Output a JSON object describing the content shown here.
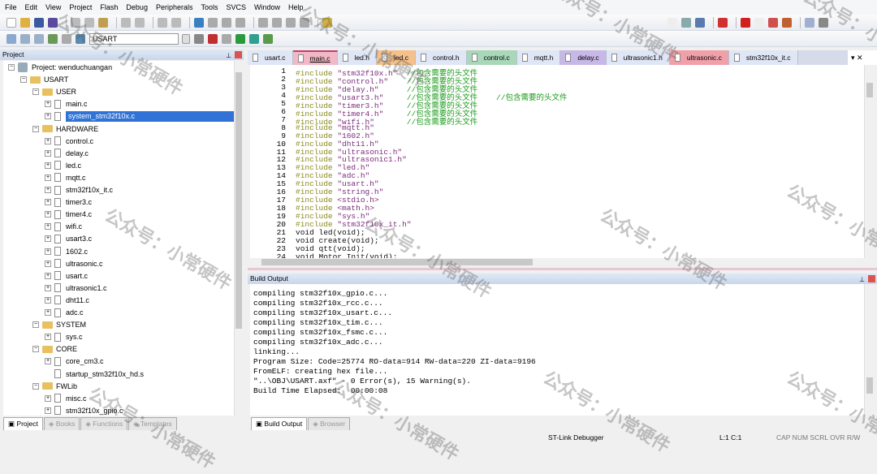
{
  "menu": [
    "File",
    "Edit",
    "View",
    "Project",
    "Flash",
    "Debug",
    "Peripherals",
    "Tools",
    "SVCS",
    "Window",
    "Help"
  ],
  "toolbar2": {
    "target": "USART"
  },
  "project_panel": {
    "title": "Project",
    "tree": [
      {
        "label": "Project: wenduchuangan",
        "level": 0,
        "type": "root"
      },
      {
        "label": "USART",
        "level": 1,
        "type": "target"
      },
      {
        "label": "USER",
        "level": 2,
        "type": "folder"
      },
      {
        "label": "main.c",
        "level": 3,
        "type": "file"
      },
      {
        "label": "system_stm32f10x.c",
        "level": 3,
        "type": "file",
        "selected": true
      },
      {
        "label": "HARDWARE",
        "level": 2,
        "type": "folder"
      },
      {
        "label": "control.c",
        "level": 3,
        "type": "file"
      },
      {
        "label": "delay.c",
        "level": 3,
        "type": "file"
      },
      {
        "label": "led.c",
        "level": 3,
        "type": "file"
      },
      {
        "label": "mqtt.c",
        "level": 3,
        "type": "file"
      },
      {
        "label": "stm32f10x_it.c",
        "level": 3,
        "type": "file"
      },
      {
        "label": "timer3.c",
        "level": 3,
        "type": "file"
      },
      {
        "label": "timer4.c",
        "level": 3,
        "type": "file"
      },
      {
        "label": "wifi.c",
        "level": 3,
        "type": "file"
      },
      {
        "label": "usart3.c",
        "level": 3,
        "type": "file"
      },
      {
        "label": "1602.c",
        "level": 3,
        "type": "file"
      },
      {
        "label": "ultrasonic.c",
        "level": 3,
        "type": "file"
      },
      {
        "label": "usart.c",
        "level": 3,
        "type": "file"
      },
      {
        "label": "ultrasonic1.c",
        "level": 3,
        "type": "file"
      },
      {
        "label": "dht11.c",
        "level": 3,
        "type": "file"
      },
      {
        "label": "adc.c",
        "level": 3,
        "type": "file"
      },
      {
        "label": "SYSTEM",
        "level": 2,
        "type": "folder"
      },
      {
        "label": "sys.c",
        "level": 3,
        "type": "file"
      },
      {
        "label": "CORE",
        "level": 2,
        "type": "folder"
      },
      {
        "label": "core_cm3.c",
        "level": 3,
        "type": "file"
      },
      {
        "label": "startup_stm32f10x_hd.s",
        "level": 3,
        "type": "file",
        "noexpand": true
      },
      {
        "label": "FWLib",
        "level": 2,
        "type": "folder"
      },
      {
        "label": "misc.c",
        "level": 3,
        "type": "file"
      },
      {
        "label": "stm32f10x_gpio.c",
        "level": 3,
        "type": "file"
      }
    ],
    "tabs": [
      "Project",
      "Books",
      "Functions",
      "Templates"
    ]
  },
  "editor": {
    "tabs": [
      {
        "label": "usart.c",
        "color": "#dfe6f5"
      },
      {
        "label": "main.c",
        "color": "#f2b8c6",
        "active": true
      },
      {
        "label": "led.h",
        "color": "#dfe6f5"
      },
      {
        "label": "led.c",
        "color": "#f5c08a"
      },
      {
        "label": "control.h",
        "color": "#dfe6f5"
      },
      {
        "label": "control.c",
        "color": "#a8d8b8"
      },
      {
        "label": "mqtt.h",
        "color": "#dfe6f5"
      },
      {
        "label": "delay.c",
        "color": "#c8b8e8"
      },
      {
        "label": "ultrasonic1.h",
        "color": "#dfe6f5"
      },
      {
        "label": "ultrasonic.c",
        "color": "#f0a0a8"
      },
      {
        "label": "stm32f10x_it.c",
        "color": "#dfe6f5"
      }
    ],
    "lines": [
      {
        "n": "1",
        "kw": "#include ",
        "arg": "\"stm32f10x.h\"",
        "pad": "  ",
        "cm": "//包含需要的头文件"
      },
      {
        "n": "2",
        "kw": "#include ",
        "arg": "\"control.h\"",
        "pad": "    ",
        "cm": "//包含需要的头文件"
      },
      {
        "n": "3",
        "kw": "#include ",
        "arg": "\"delay.h\"",
        "pad": "      ",
        "cm": "//包含需要的头文件"
      },
      {
        "n": "4",
        "kw": "#include ",
        "arg": "\"usart3.h\"",
        "pad": "     ",
        "cm": "//包含需要的头文件    //包含需要的头文件"
      },
      {
        "n": "5",
        "kw": "#include ",
        "arg": "\"timer3.h\"",
        "pad": "     ",
        "cm": "//包含需要的头文件"
      },
      {
        "n": "6",
        "kw": "#include ",
        "arg": "\"timer4.h\"",
        "pad": "     ",
        "cm": "//包含需要的头文件"
      },
      {
        "n": "7",
        "kw": "#include ",
        "arg": "\"wifi.h\"",
        "pad": "       ",
        "cm": "//包含需要的头文件"
      },
      {
        "n": "8",
        "kw": "#include ",
        "arg": "\"mqtt.h\""
      },
      {
        "n": "9",
        "kw": "#include ",
        "arg": "\"1602.h\""
      },
      {
        "n": "10",
        "kw": "#include ",
        "arg": "\"dht11.h\""
      },
      {
        "n": "11",
        "kw": "#include ",
        "arg": "\"ultrasonic.h\""
      },
      {
        "n": "12",
        "kw": "#include ",
        "arg": "\"ultrasonic1.h\""
      },
      {
        "n": "13",
        "kw": "#include ",
        "arg": "\"led.h\""
      },
      {
        "n": "14",
        "kw": "#include ",
        "arg": "\"adc.h\""
      },
      {
        "n": "15",
        "kw": "#include ",
        "arg": "\"usart.h\""
      },
      {
        "n": "16",
        "kw": "#include ",
        "arg": "\"string.h\""
      },
      {
        "n": "17",
        "kw": "#include ",
        "arg": "<stdio.h>"
      },
      {
        "n": "18",
        "kw": "#include ",
        "arg": "<math.h>"
      },
      {
        "n": "19",
        "kw": "#include ",
        "arg": "\"sys.h\""
      },
      {
        "n": "20",
        "kw": "#include ",
        "arg": "\"stm32f10x_it.h\""
      },
      {
        "n": "21",
        "pl": "void led(void);"
      },
      {
        "n": "22",
        "pl": "void create(void);"
      },
      {
        "n": "23",
        "pl": "void qtt(void);"
      },
      {
        "n": "24",
        "pl": "void Motor_Init(void);"
      }
    ]
  },
  "build_output": {
    "title": "Build Output",
    "lines": [
      "compiling stm32f10x_gpio.c...",
      "compiling stm32f10x_rcc.c...",
      "compiling stm32f10x_usart.c...",
      "compiling stm32f10x_tim.c...",
      "compiling stm32f10x_fsmc.c...",
      "compiling stm32f10x_adc.c...",
      "linking...",
      "Program Size: Code=25774 RO-data=914 RW-data=220 ZI-data=9196",
      "FromELF: creating hex file...",
      "\"..\\OBJ\\USART.axf\" - 0 Error(s), 15 Warning(s).",
      "Build Time Elapsed:  00:00:08"
    ],
    "tabs": [
      "Build Output",
      "Browser"
    ]
  },
  "status": {
    "debugger": "ST-Link Debugger",
    "position": "L:1 C:1",
    "indicators": "CAP NUM SCRL OVR R/W"
  },
  "watermark": "公众号：小常硬件"
}
